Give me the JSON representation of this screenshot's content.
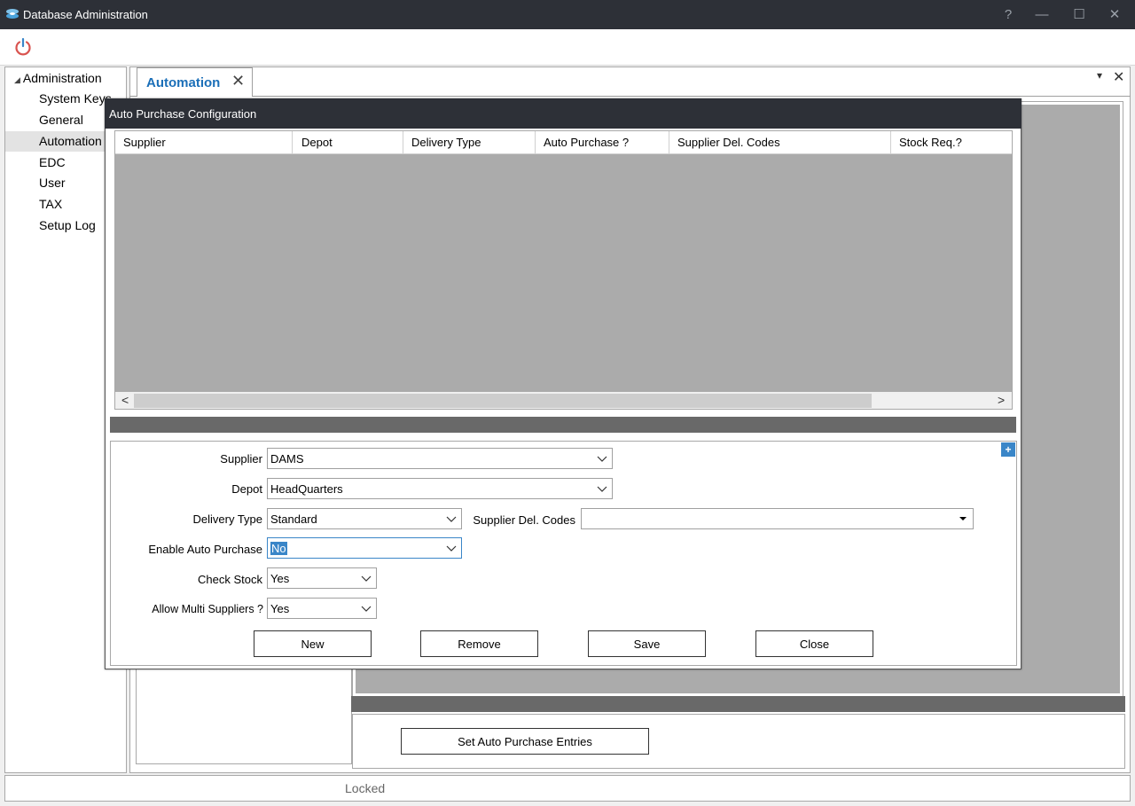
{
  "window": {
    "title": "Database Administration",
    "controls": {
      "help": "?",
      "minimize": "—",
      "maximize": "☐",
      "close": "✕"
    }
  },
  "tree": {
    "root": "Administration",
    "items": [
      {
        "label": "System Keys"
      },
      {
        "label": "General"
      },
      {
        "label": "Automation",
        "selected": true
      },
      {
        "label": "EDC"
      },
      {
        "label": "User"
      },
      {
        "label": "TAX"
      },
      {
        "label": "Setup Log"
      }
    ]
  },
  "tab": {
    "label": "Automation",
    "close": "✕"
  },
  "panel_controls": {
    "dropdown": "▾",
    "close": "✕"
  },
  "set_auto_purchase_label": "Set Auto Purchase Entries",
  "status": "Locked",
  "dialog": {
    "title": "Auto Purchase Configuration",
    "grid": {
      "columns": [
        "Supplier",
        "Depot",
        "Delivery Type",
        "Auto Purchase ?",
        "Supplier Del. Codes",
        "Stock Req.?"
      ],
      "scroll_left": "<",
      "scroll_right": ">"
    },
    "expand_button": "+",
    "form": {
      "supplier": {
        "label": "Supplier",
        "value": "DAMS"
      },
      "depot": {
        "label": "Depot",
        "value": "HeadQuarters"
      },
      "delivery_type": {
        "label": "Delivery Type",
        "value": "Standard"
      },
      "supplier_del_codes": {
        "label": "Supplier Del. Codes",
        "value": ""
      },
      "enable_auto_purchase": {
        "label": "Enable Auto Purchase",
        "value": "No"
      },
      "check_stock": {
        "label": "Check Stock",
        "value": "Yes"
      },
      "allow_multi_suppliers": {
        "label": "Allow Multi Suppliers ?",
        "value": "Yes"
      }
    },
    "buttons": {
      "new": "New",
      "remove": "Remove",
      "save": "Save",
      "close": "Close"
    }
  },
  "colors": {
    "titlebar": "#2d3037",
    "accent": "#1b6fb8",
    "grid_bg": "#ababab",
    "bar": "#696969"
  }
}
